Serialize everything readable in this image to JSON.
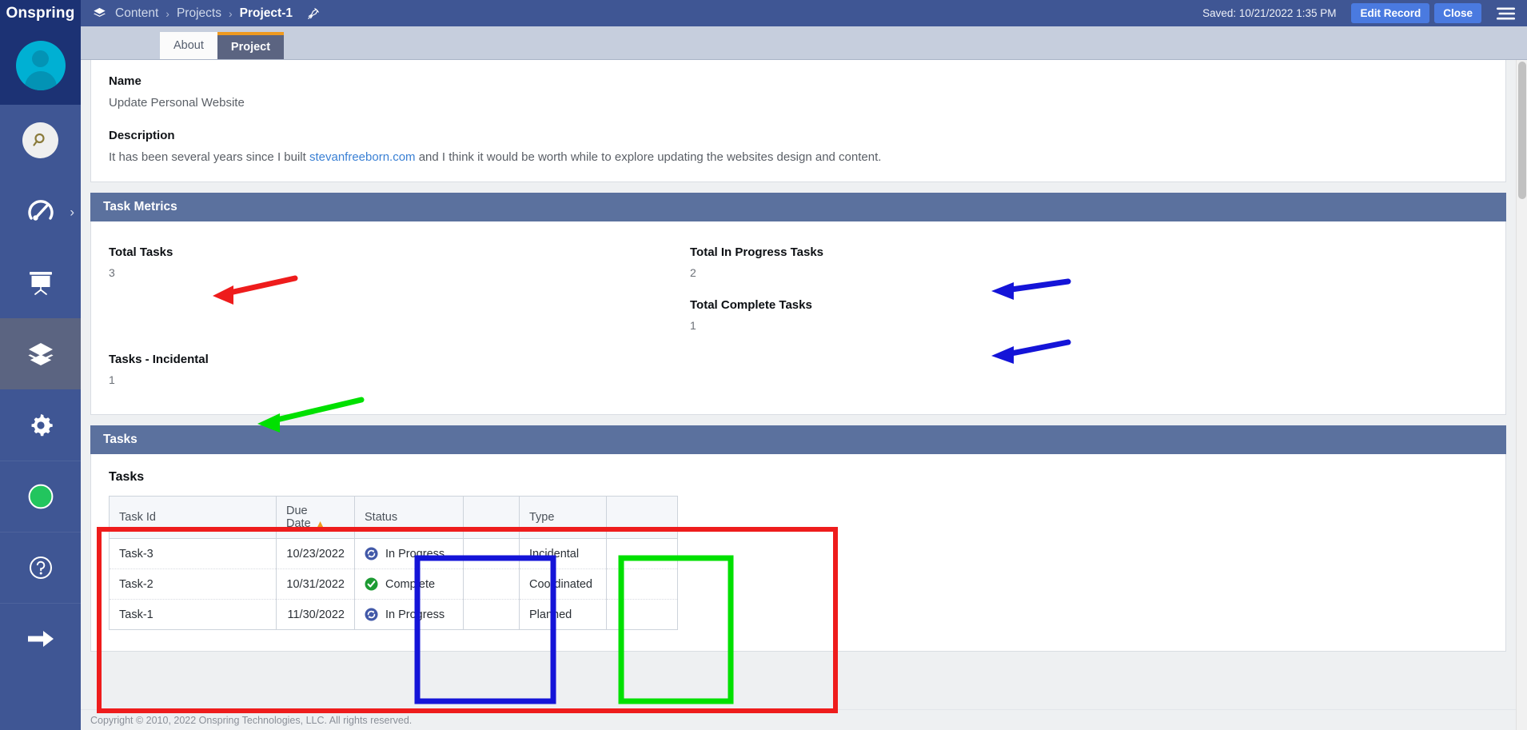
{
  "brand": {
    "name": "Onspring"
  },
  "topbar": {
    "breadcrumb": {
      "root": "Content",
      "section": "Projects",
      "current": "Project-1"
    },
    "saved_text": "Saved: 10/21/2022 1:35 PM",
    "edit_label": "Edit Record",
    "close_label": "Close"
  },
  "tabs": [
    {
      "label": "About",
      "active": false
    },
    {
      "label": "Project",
      "active": true
    }
  ],
  "rail": {
    "items": [
      {
        "name": "search",
        "icon": "search-icon"
      },
      {
        "name": "dashboards",
        "icon": "gauge-icon",
        "chevron": "›"
      },
      {
        "name": "reports",
        "icon": "presentation-icon"
      },
      {
        "name": "content",
        "icon": "layers-icon",
        "active": true
      },
      {
        "name": "admin",
        "icon": "gear-icon"
      },
      {
        "name": "status",
        "icon": "green-circle-icon"
      },
      {
        "name": "help",
        "icon": "question-circle-icon"
      },
      {
        "name": "signout",
        "icon": "arrow-right-icon"
      }
    ]
  },
  "record": {
    "name_label": "Name",
    "name_value": "Update Personal Website",
    "description_label": "Description",
    "description_pre": "It has been several years since I built ",
    "description_link": "stevanfreeborn.com",
    "description_post": " and I think it would be worth while to explore updating the websites design and content."
  },
  "task_metrics": {
    "section_title": "Task Metrics",
    "metrics": [
      {
        "label": "Total Tasks",
        "value": "3"
      },
      {
        "label": "Tasks - Incidental",
        "value": "1"
      },
      {
        "label": "Total In Progress Tasks",
        "value": "2"
      },
      {
        "label": "Total Complete Tasks",
        "value": "1"
      }
    ]
  },
  "tasks_section": {
    "section_title": "Tasks",
    "list_title": "Tasks",
    "columns": [
      "Task Id",
      "Due Date",
      "Status",
      "",
      "Type",
      ""
    ],
    "sort_indicator": "▲",
    "rows": [
      {
        "task_id": "Task-3",
        "due_date": "10/23/2022",
        "status": "In Progress",
        "status_icon": "in-progress-icon",
        "blank": "",
        "type": "Incidental",
        "end": ""
      },
      {
        "task_id": "Task-2",
        "due_date": "10/31/2022",
        "status": "Complete",
        "status_icon": "complete-icon",
        "blank": "",
        "type": "Coordinated",
        "end": ""
      },
      {
        "task_id": "Task-1",
        "due_date": "11/30/2022",
        "status": "In Progress",
        "status_icon": "in-progress-icon",
        "blank": "",
        "type": "Planned",
        "end": ""
      }
    ]
  },
  "footer": {
    "copyright": "Copyright © 2010, 2022 Onspring Technologies, LLC. All rights reserved."
  },
  "colors": {
    "brand_dark": "#1c3274",
    "rail_blue": "#3f5694",
    "topbar_blue": "#3f5694",
    "button_blue": "#4a7ae0",
    "section_header": "#5b719e",
    "tab_active": "#5b6481",
    "tab_accent": "#f09a1f",
    "link": "#3a80d4",
    "annotation_red": "#ee1c1c",
    "annotation_blue": "#1414d8",
    "annotation_green": "#00e000",
    "status_complete": "#2a9d3f",
    "status_in_progress": "#3b5bb5"
  },
  "annotations": [
    {
      "name": "red-arrow-total-tasks",
      "color": "#ee1c1c",
      "shape": "arrow"
    },
    {
      "name": "green-arrow-tasks-incidental",
      "color": "#00e000",
      "shape": "arrow"
    },
    {
      "name": "blue-arrow-total-in-progress-tasks",
      "color": "#1414d8",
      "shape": "arrow"
    },
    {
      "name": "blue-arrow-total-complete-tasks",
      "color": "#1414d8",
      "shape": "arrow"
    },
    {
      "name": "red-box-tasks-list",
      "color": "#ee1c1c",
      "shape": "rect"
    },
    {
      "name": "blue-box-status-column",
      "color": "#1414d8",
      "shape": "rect"
    },
    {
      "name": "green-box-type-column",
      "color": "#00e000",
      "shape": "rect"
    }
  ]
}
